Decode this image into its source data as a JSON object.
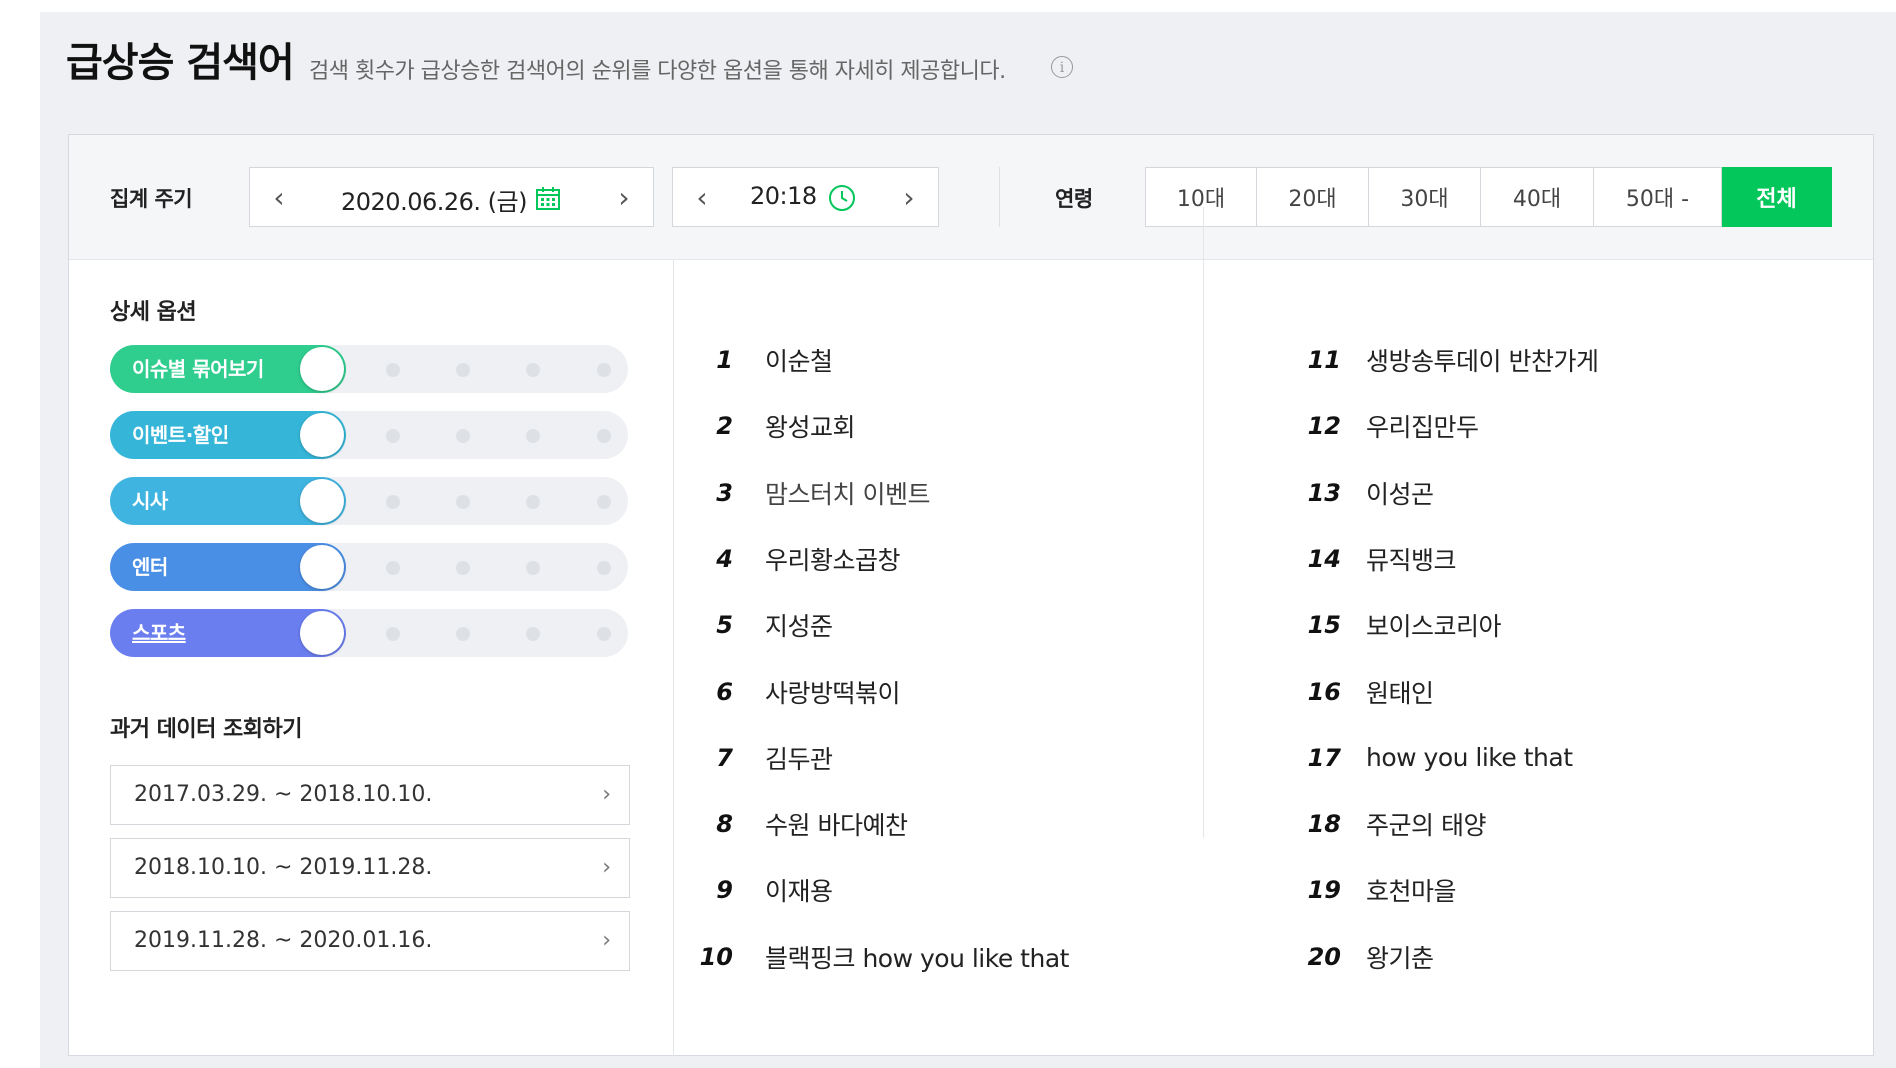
{
  "header": {
    "title": "급상승 검색어",
    "description": "검색 횟수가 급상승한 검색어의 순위를 다양한 옵션을 통해 자세히 제공합니다."
  },
  "filters": {
    "period_label": "집계 주기",
    "date": "2020.06.26. (금)",
    "time": "20:18",
    "age_label": "연령",
    "ages": [
      "10대",
      "20대",
      "30대",
      "40대",
      "50대 -",
      "전체"
    ],
    "selected_age": "전체"
  },
  "options": {
    "title": "상세 옵션",
    "toggles": [
      {
        "label": "이슈별 묶어보기",
        "color": "#2fce8f",
        "on": true
      },
      {
        "label": "이벤트·할인",
        "color": "#35b6d8",
        "on": true
      },
      {
        "label": "시사",
        "color": "#3fb4e0",
        "on": true
      },
      {
        "label": "엔터",
        "color": "#4a8fe6",
        "on": true
      },
      {
        "label": "스포츠",
        "color": "#6a7ef0",
        "on": true
      }
    ]
  },
  "past": {
    "title": "과거 데이터 조회하기",
    "periods": [
      "2017.03.29. ~ 2018.10.10.",
      "2018.10.10. ~ 2019.11.28.",
      "2019.11.28. ~ 2020.01.16."
    ]
  },
  "rankings": [
    {
      "rank": "1",
      "keyword": "이순철"
    },
    {
      "rank": "2",
      "keyword": "왕성교회"
    },
    {
      "rank": "3",
      "keyword": "맘스터치 이벤트"
    },
    {
      "rank": "4",
      "keyword": "우리황소곱창"
    },
    {
      "rank": "5",
      "keyword": "지성준"
    },
    {
      "rank": "6",
      "keyword": "사랑방떡볶이"
    },
    {
      "rank": "7",
      "keyword": "김두관"
    },
    {
      "rank": "8",
      "keyword": "수원 바다예찬"
    },
    {
      "rank": "9",
      "keyword": "이재용"
    },
    {
      "rank": "10",
      "keyword": "블랙핑크 how you like that"
    },
    {
      "rank": "11",
      "keyword": "생방송투데이 반찬가게"
    },
    {
      "rank": "12",
      "keyword": "우리집만두"
    },
    {
      "rank": "13",
      "keyword": "이성곤"
    },
    {
      "rank": "14",
      "keyword": "뮤직뱅크"
    },
    {
      "rank": "15",
      "keyword": "보이스코리아"
    },
    {
      "rank": "16",
      "keyword": "원태인"
    },
    {
      "rank": "17",
      "keyword": "how you like that"
    },
    {
      "rank": "18",
      "keyword": "주군의 태양"
    },
    {
      "rank": "19",
      "keyword": "호천마을"
    },
    {
      "rank": "20",
      "keyword": "왕기춘"
    }
  ],
  "highlighted_rank": "3",
  "colors": {
    "accent": "#03c75a",
    "highlight": "#fbe79a"
  },
  "icons": {
    "info": "info-icon",
    "calendar": "calendar-icon",
    "clock": "clock-icon",
    "prev": "chevron-left-icon",
    "next": "chevron-right-icon"
  }
}
